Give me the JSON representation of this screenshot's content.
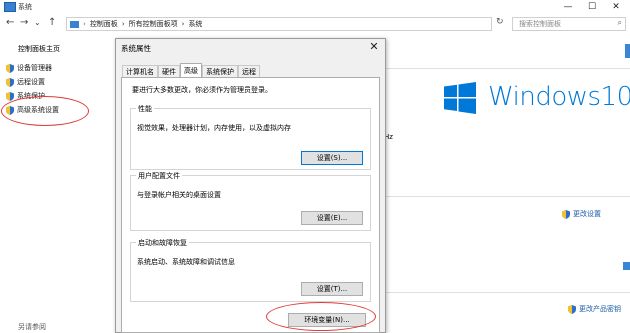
{
  "window": {
    "title": "系统",
    "buttons": {
      "minimize": "—",
      "maximize": "☐",
      "close": "✕"
    }
  },
  "address": {
    "crumbs": [
      "控制面板",
      "›",
      "所有控制面板项",
      "›",
      "系统"
    ],
    "search_placeholder": "搜索控制面板"
  },
  "nav": {
    "back": "←",
    "forward": "→",
    "up": "↑",
    "refresh": "↻",
    "dropdown": "⌄"
  },
  "left": {
    "home": "控制面板主页",
    "links": [
      "设备管理器",
      "远程设置",
      "系统保护",
      "高级系统设置"
    ],
    "see_also": "另请参阅"
  },
  "right": {
    "brand": "Windows10",
    "hz_text": "Hz",
    "change_settings": "更改设置",
    "change_product_key": "更改产品密钥"
  },
  "dialog": {
    "title": "系统属性",
    "close": "✕",
    "tabs": [
      "计算机名",
      "硬件",
      "高级",
      "系统保护",
      "远程"
    ],
    "active_tab": "高级",
    "admin_note": "要进行大多数更改，你必须作为管理员登录。",
    "groups": [
      {
        "title": "性能",
        "desc": "视觉效果，处理器计划，内存使用，以及虚拟内存",
        "button": "设置(S)..."
      },
      {
        "title": "用户配置文件",
        "desc": "与登录帐户相关的桌面设置",
        "button": "设置(E)..."
      },
      {
        "title": "启动和故障恢复",
        "desc": "系统启动、系统故障和调试信息",
        "button": "设置(T)..."
      }
    ],
    "env_button": "环境变量(N)..."
  },
  "colors": {
    "accent": "#0078d7",
    "highlight": "#e23b3b",
    "link": "#1a5aa8"
  }
}
